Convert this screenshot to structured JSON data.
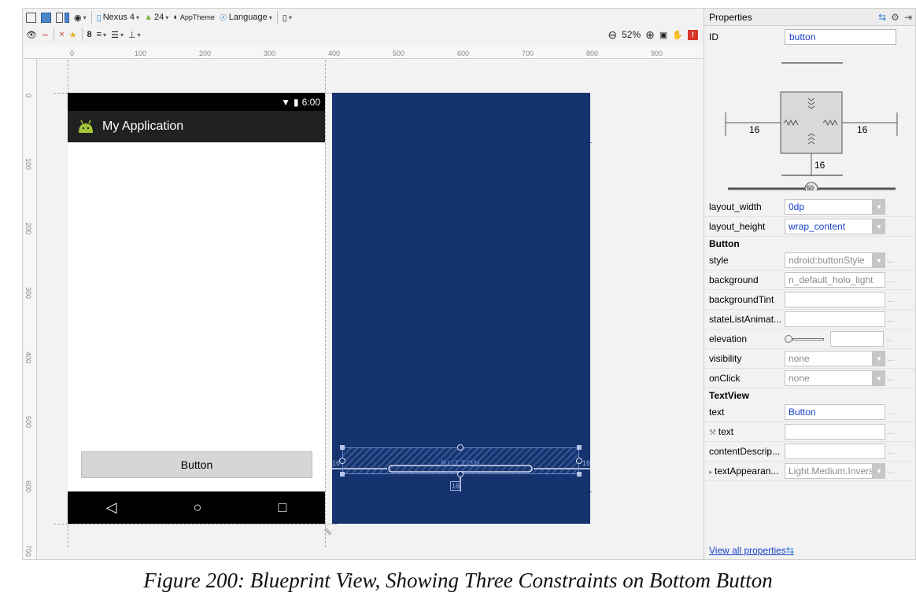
{
  "toolbar": {
    "device": "Nexus 4",
    "api": "24",
    "theme": "AppTheme",
    "language": "Language",
    "margin_value": "8",
    "zoom": "52%"
  },
  "ruler": {
    "h_ticks": [
      "0",
      "100",
      "200",
      "300",
      "400",
      "500",
      "600",
      "700",
      "800",
      "900"
    ],
    "v_ticks": [
      "0",
      "100",
      "200",
      "300",
      "400",
      "500",
      "600",
      "700"
    ]
  },
  "device": {
    "status_time": "6:00",
    "app_title": "My Application",
    "button_label": "Button"
  },
  "blueprint": {
    "button_label": "BUTTON",
    "left_margin": "16",
    "right_margin": "16",
    "bottom_margin": "16"
  },
  "properties": {
    "title": "Properties",
    "id_label": "ID",
    "id_value": "button",
    "inspector": {
      "left": "16",
      "right": "16",
      "bottom": "16",
      "bias": "50"
    },
    "rows_top": [
      {
        "label": "layout_width",
        "value": "0dp",
        "dropdown": true
      },
      {
        "label": "layout_height",
        "value": "wrap_content",
        "dropdown": true
      }
    ],
    "section_button": "Button",
    "rows_button": [
      {
        "label": "style",
        "value": "ndroid:buttonStyle",
        "dropdown": true,
        "gray": true
      },
      {
        "label": "background",
        "value": "n_default_holo_light",
        "dropdown": false,
        "gray": true
      },
      {
        "label": "backgroundTint",
        "value": "",
        "dropdown": false
      },
      {
        "label": "stateListAnimat...",
        "value": "",
        "dropdown": false
      },
      {
        "label": "elevation",
        "value": "",
        "dropdown": false
      },
      {
        "label": "visibility",
        "value": "none",
        "dropdown": true,
        "gray": true
      },
      {
        "label": "onClick",
        "value": "none",
        "dropdown": true,
        "gray": true
      }
    ],
    "section_textview": "TextView",
    "rows_textview": [
      {
        "label": "text",
        "value": "Button",
        "dropdown": false
      },
      {
        "label": "text",
        "value": "",
        "dropdown": false,
        "wrench": true
      },
      {
        "label": "contentDescrip...",
        "value": "",
        "dropdown": false
      },
      {
        "label": "textAppearan...",
        "value": "Light.Medium.Inverse",
        "dropdown": true,
        "gray": true,
        "expander": true
      }
    ],
    "view_all": "View all properties"
  },
  "caption": "Figure 200: Blueprint View, Showing Three Constraints on Bottom Button"
}
